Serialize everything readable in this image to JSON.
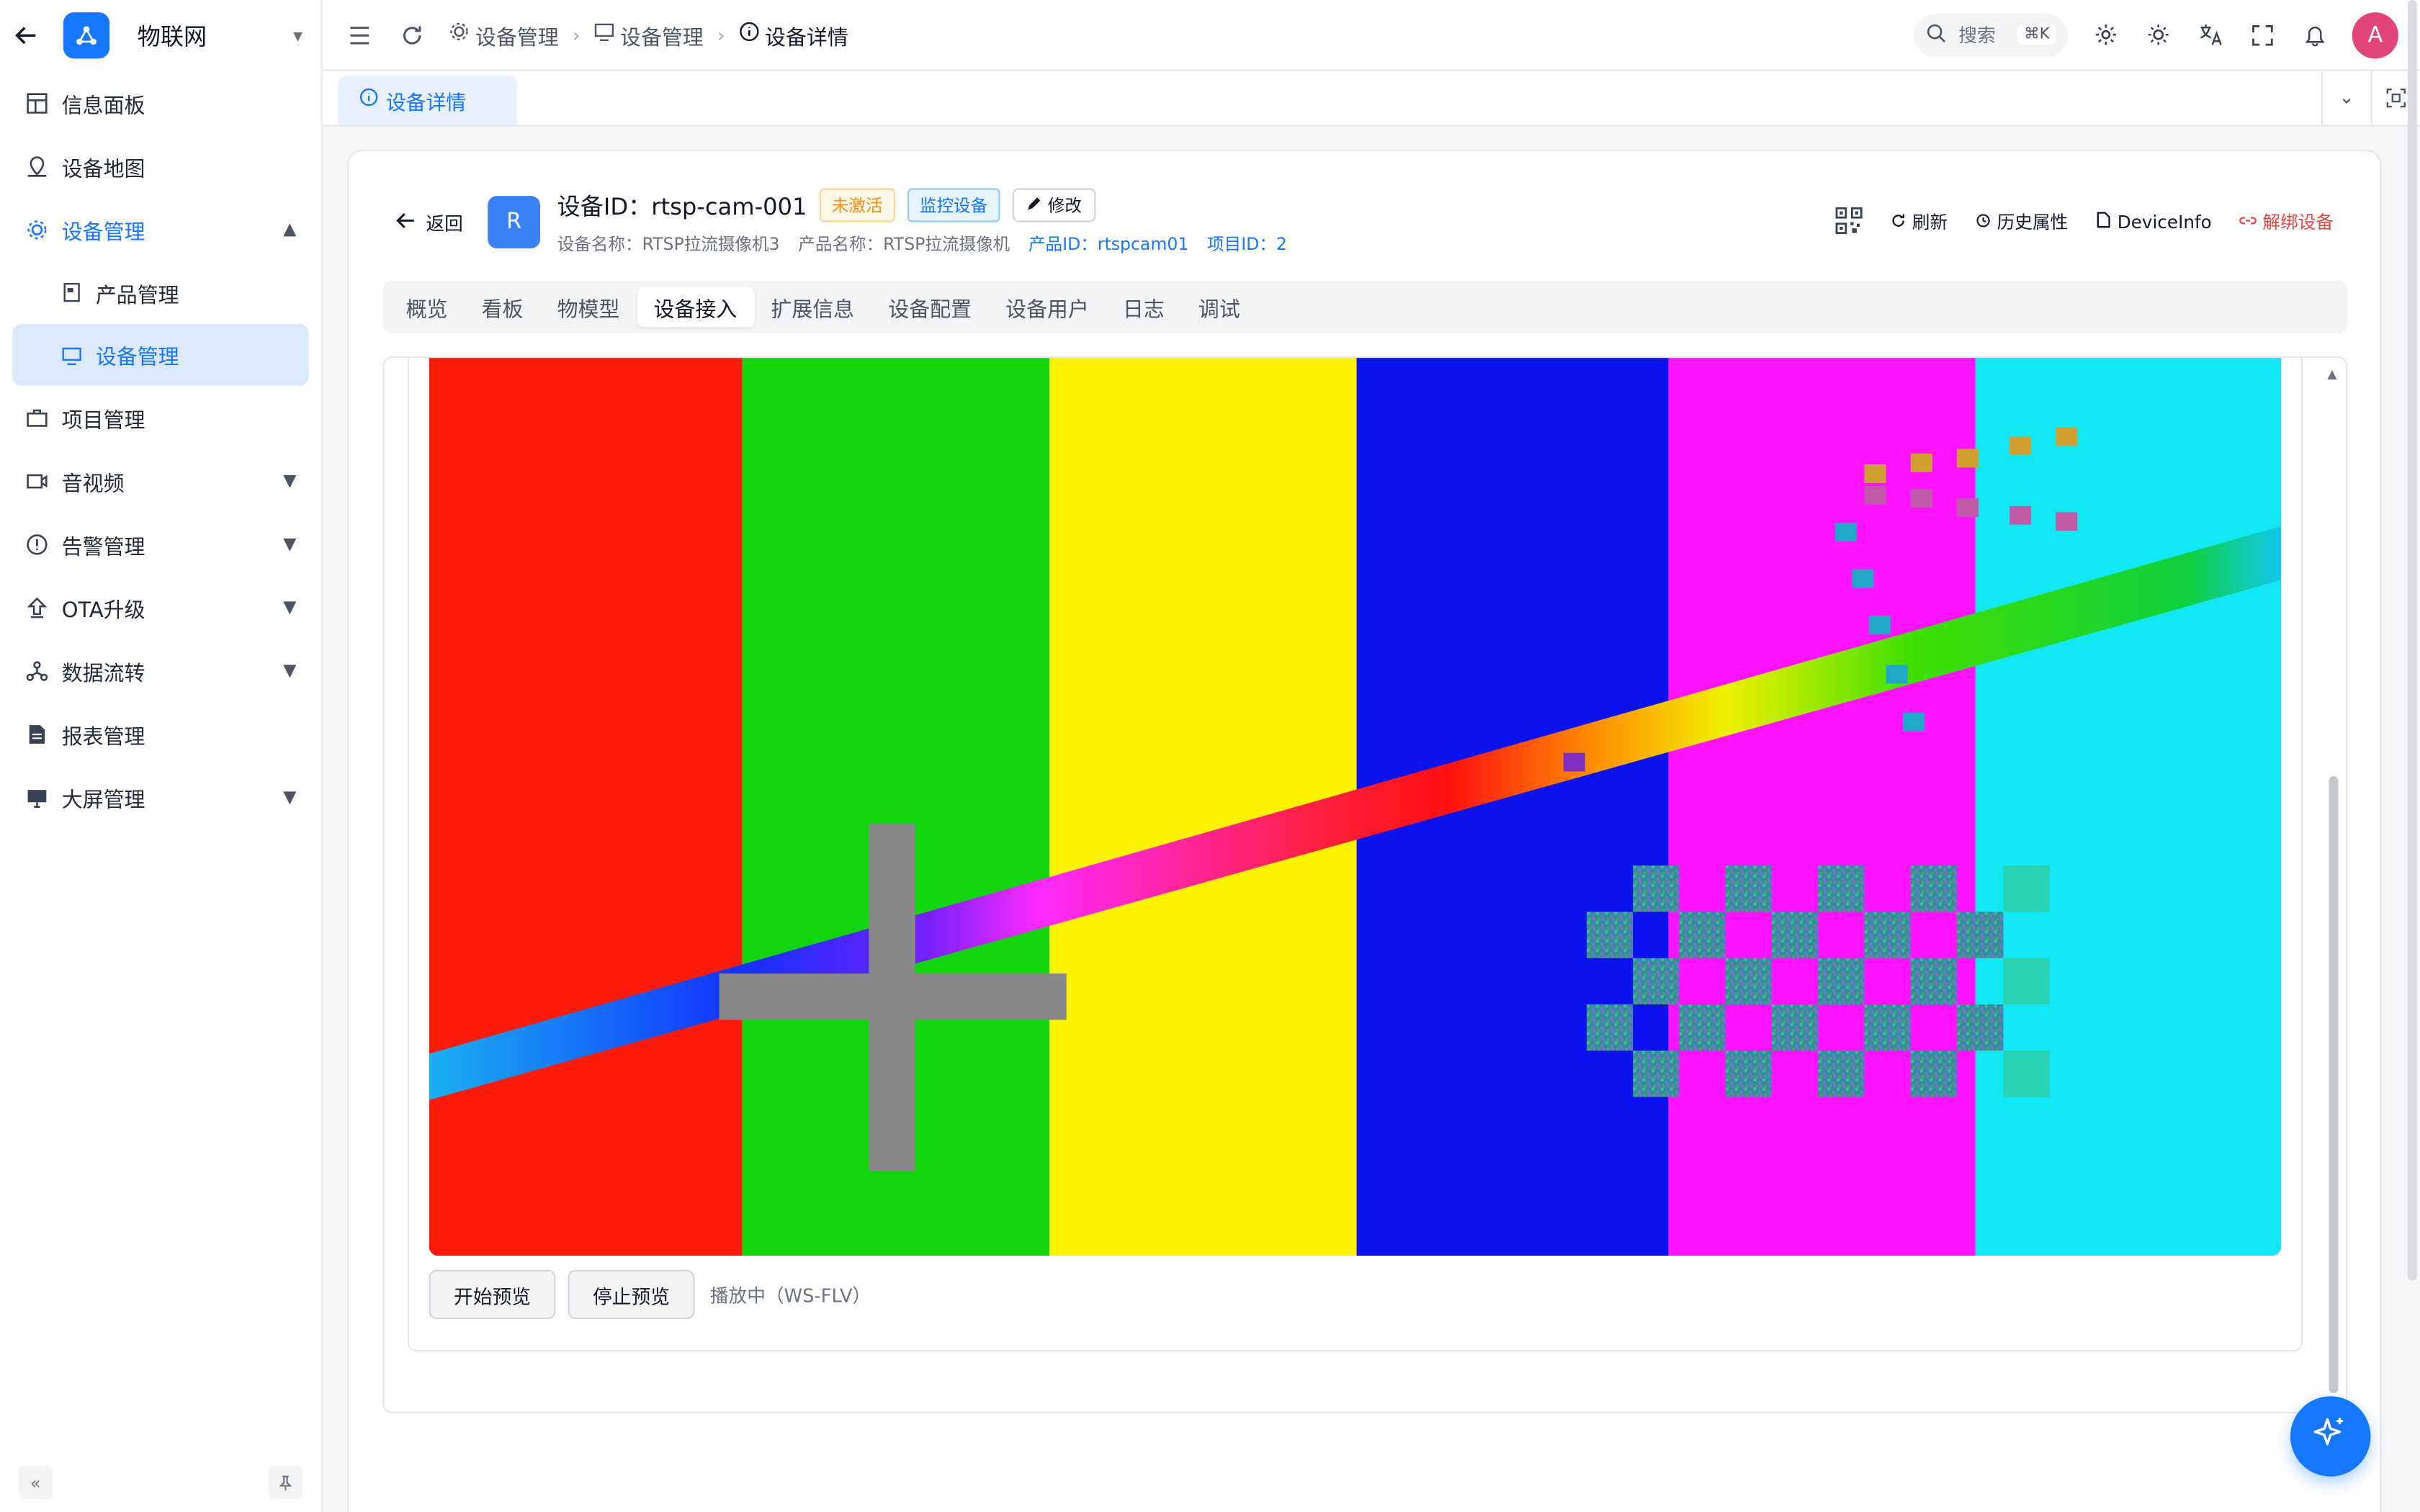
{
  "app": {
    "title": "物联网"
  },
  "sidebar": {
    "items": [
      {
        "label": "信息面板",
        "icon": "dashboard-icon"
      },
      {
        "label": "设备地图",
        "icon": "map-icon"
      },
      {
        "label": "设备管理",
        "icon": "device-icon",
        "expanded": true
      },
      {
        "label": "产品管理",
        "icon": "product-icon"
      },
      {
        "label": "设备管理",
        "icon": "device-list-icon",
        "active": true
      },
      {
        "label": "项目管理",
        "icon": "briefcase-icon"
      },
      {
        "label": "音视频",
        "icon": "video-icon"
      },
      {
        "label": "告警管理",
        "icon": "alert-icon"
      },
      {
        "label": "OTA升级",
        "icon": "upload-icon"
      },
      {
        "label": "数据流转",
        "icon": "flow-icon"
      },
      {
        "label": "报表管理",
        "icon": "report-icon"
      },
      {
        "label": "大屏管理",
        "icon": "monitor-icon"
      }
    ]
  },
  "breadcrumb": [
    "设备管理",
    "设备管理",
    "设备详情"
  ],
  "search": {
    "placeholder": "搜索",
    "shortcut": "⌘K"
  },
  "user": {
    "avatar_letter": "A"
  },
  "tabs": [
    {
      "label": "设备详情"
    }
  ],
  "device": {
    "back_label": "返回",
    "badge_letter": "R",
    "id_label": "设备ID：rtsp-cam-001",
    "status_tag": "未激活",
    "type_tag": "监控设备",
    "edit_label": "修改",
    "name": "设备名称：RTSP拉流摄像机3",
    "product_name": "产品名称：RTSP拉流摄像机",
    "product_id": "产品ID：rtspcam01",
    "project_id": "项目ID：2"
  },
  "actions": {
    "refresh": "刷新",
    "history": "历史属性",
    "device_info": "DeviceInfo",
    "unbind": "解绑设备"
  },
  "subtabs": [
    "概览",
    "看板",
    "物模型",
    "设备接入",
    "扩展信息",
    "设备配置",
    "设备用户",
    "日志",
    "调试"
  ],
  "active_subtab": "设备接入",
  "player": {
    "start_label": "开始预览",
    "stop_label": "停止预览",
    "status": "播放中（WS-FLV）"
  },
  "colors": {
    "accent": "#1677ff",
    "danger": "#ef4444",
    "warning": "#fa8c16"
  }
}
